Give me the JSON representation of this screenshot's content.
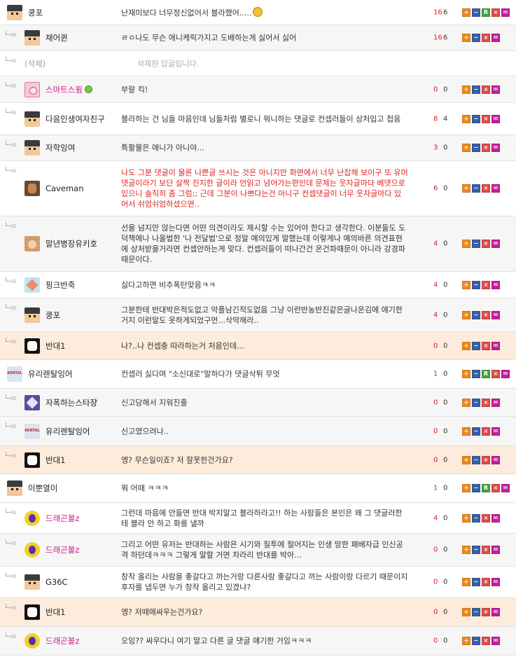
{
  "reply_marker": "RE",
  "rows": [
    {
      "re": false,
      "avatar": "pixel",
      "author": "쿵포",
      "content": "난재미보다 너무정신없어서 블라했어.....",
      "emoji": true,
      "up": "16",
      "down": "6",
      "bg": "alt",
      "buttons": [
        "plus",
        "minus",
        "rep",
        "del",
        "msg"
      ],
      "h": 36
    },
    {
      "re": true,
      "avatar": "pixel",
      "author": "채어퀸",
      "content": "ㄹㅇ나도 무슨 애니케릭가지고 도배하는게 싫어서 싫어",
      "up": "16",
      "down": "6",
      "bg": "grey",
      "buttons": [
        "plus",
        "minus",
        "del",
        "msg"
      ],
      "h": 37
    },
    {
      "re": true,
      "avatar": "",
      "author": "(삭제)",
      "deleted": true,
      "content": "삭제된 답글입니다.",
      "content_style": "grey",
      "up": "",
      "down": "",
      "bg": "alt",
      "buttons": [],
      "h": 36
    },
    {
      "re": true,
      "avatar": "pink",
      "author": "스마트스윔",
      "author_style": "pink",
      "online": true,
      "content": "부랄 킥!",
      "up": "0",
      "down": "0",
      "bg": "grey",
      "buttons": [
        "plus",
        "minus",
        "del",
        "msg"
      ],
      "h": 38
    },
    {
      "re": true,
      "avatar": "pixel",
      "author": "다음인생여자친구",
      "content": "블라하는 건 님들 마음인데 님들처럼 별로니 뭐니하는 댓글로 컨셉러들이 상처입고 접음",
      "up": "8",
      "down": "4",
      "bg": "alt",
      "buttons": [
        "plus",
        "minus",
        "del",
        "msg"
      ],
      "h": 46
    },
    {
      "re": true,
      "avatar": "pixel",
      "author": "자학잉여",
      "content": "특활물은 애니가 아니야...",
      "up": "3",
      "down": "0",
      "bg": "grey",
      "buttons": [
        "plus",
        "minus",
        "del",
        "msg"
      ],
      "h": 37
    },
    {
      "re": true,
      "avatar": "cave",
      "author": "Caveman",
      "content": "나도 그분 댓글이 물론 나쁜글 쓰시는 것은 아니지만 화면에서 너무 난잡해 보이구 또 유머댓글이라기 보단 살짝 진지한 글이라 안읽고 넘어가는편인데 문제는 웃자글마다 베댓으로 있으니 솔직히 좀 그럼;; 근데 그분이 나쁘다는건 아니구 컨셉댓글이 너무 웃자글마다 있어서 쉬엄쉬엄하셨으면..",
      "content_style": "red",
      "up": "6",
      "down": "0",
      "bg": "alt",
      "buttons": [
        "plus",
        "minus",
        "del",
        "msg"
      ],
      "h": 79
    },
    {
      "re": true,
      "avatar": "girl",
      "author": "말년병장유키호",
      "content": "선을 넘지만 않는다면 어떤 의견이라도 제시할 수는 있어야 한다고 생각한다. 이분들도 도덕책에나 나올법한 '나 전달법'으로 정말 예의있게 말했는데 이렇게나 예의바른 의견표현에 상처받을거라면 컨셉안하는게 맞다. 컨셉러들이 떠나간건 온건파때문이 아니라 강경파 때문이다.",
      "up": "4",
      "down": "0",
      "bg": "grey",
      "buttons": [
        "plus",
        "minus",
        "del",
        "msg"
      ],
      "h": 79
    },
    {
      "re": true,
      "avatar": "fox",
      "author": "핑크반죽",
      "content": "싫다고하면 비추폭탄맞음ㅋㅋ",
      "up": "4",
      "down": "0",
      "bg": "alt",
      "buttons": [
        "plus",
        "minus",
        "del",
        "msg"
      ],
      "h": 38
    },
    {
      "re": true,
      "avatar": "pixel",
      "author": "쿵포",
      "content": "그분한테 반대박은적도없고 악플남긴적도없음 그냥 이런반농반진같은글나온김에 얘기한거지 이런말도 못하게되었구먼...삭막해라..",
      "up": "4",
      "down": "0",
      "bg": "grey",
      "buttons": [
        "plus",
        "minus",
        "del",
        "msg"
      ],
      "h": 48
    },
    {
      "re": true,
      "avatar": "white",
      "author": "반대1",
      "content": "나?..나 컨셉충 따라하는거 처음인데...",
      "up": "0",
      "down": "0",
      "bg": "hl",
      "buttons": [
        "plus",
        "minus",
        "del",
        "msg"
      ],
      "h": 40
    },
    {
      "re": false,
      "avatar": "rental",
      "author": "유리렌탈잉어",
      "content": "컨셉러 싫다며 \"소신대로\"말하다가 댓글삭튀 무엇",
      "up": "1",
      "down": "0",
      "bg": "alt",
      "buttons": [
        "plus",
        "minus",
        "rep",
        "del",
        "msg"
      ],
      "h": 41
    },
    {
      "re": true,
      "avatar": "star",
      "author": "자폭하는스타쟝",
      "content": "신고당해서 지워진줄",
      "up": "0",
      "down": "0",
      "bg": "grey",
      "buttons": [
        "plus",
        "minus",
        "del",
        "msg"
      ],
      "h": 40
    },
    {
      "re": true,
      "avatar": "rental",
      "author": "유리렌탈잉어",
      "content": "신고였으려나..",
      "up": "0",
      "down": "0",
      "bg": "grey",
      "buttons": [
        "plus",
        "minus",
        "del",
        "msg"
      ],
      "h": 42
    },
    {
      "re": true,
      "avatar": "white",
      "author": "반대1",
      "content": "엥? 무슨일이죠? 저 잘못한건가요?",
      "up": "0",
      "down": "0",
      "bg": "hl",
      "buttons": [
        "plus",
        "minus",
        "del",
        "msg"
      ],
      "h": 40
    },
    {
      "re": false,
      "avatar": "pixel",
      "author": "이뿐열이",
      "content": "뭐 어때 ㅋㅋㅋ",
      "up": "1",
      "down": "0",
      "bg": "alt",
      "buttons": [
        "plus",
        "minus",
        "rep",
        "del",
        "msg"
      ],
      "h": 41
    },
    {
      "re": true,
      "avatar": "dragon",
      "author": "드래곤볼z",
      "author_style": "pink",
      "content": "그런데 마음에 안들면 반대 박지말고 블라하라고!! 하는 사람들은 본인은 왜 그 댓글러한테 블라 안 하고 화를 낼까",
      "up": "4",
      "down": "0",
      "bg": "alt",
      "buttons": [
        "plus",
        "minus",
        "del",
        "msg"
      ],
      "h": 44
    },
    {
      "re": true,
      "avatar": "dragon",
      "author": "드래곤볼z",
      "author_style": "pink",
      "content": "그리고 어떤 유저는 반대하는 사람은 시기와 질투에 절어지는 인생 망한 패배자급 인신공격 하던데ㅋㅋㅋ 그렇게 말할 거면 차라리 반대를 박아...",
      "up": "0",
      "down": "0",
      "bg": "grey",
      "buttons": [
        "plus",
        "minus",
        "del",
        "msg"
      ],
      "h": 47
    },
    {
      "re": true,
      "avatar": "pixel",
      "author": "G36C",
      "content": "창작 올리는 사람을 좋갈다고 까는거랑 다른사람 좋갈다고 까는 사람이랑 다르기 때문이지 후자를 냅두면 누가 창작 올리고 있겠냐?",
      "up": "0",
      "down": "0",
      "bg": "alt",
      "buttons": [
        "plus",
        "minus",
        "del",
        "msg"
      ],
      "h": 45
    },
    {
      "re": true,
      "avatar": "white",
      "author": "반대1",
      "content": "엥? 저때매싸우는건가요?",
      "up": "0",
      "down": "0",
      "bg": "hl",
      "buttons": [
        "plus",
        "minus",
        "del",
        "msg"
      ],
      "h": 41
    },
    {
      "re": true,
      "avatar": "dragon",
      "author": "드래곤볼z",
      "author_style": "pink",
      "content": "오잉?? 싸우다니 여기 말고 다른 글 댓글 얘기한 거임ㅋㅋㅋ",
      "up": "0",
      "down": "0",
      "bg": "grey",
      "buttons": [
        "plus",
        "minus",
        "del",
        "msg"
      ],
      "h": 41
    }
  ]
}
